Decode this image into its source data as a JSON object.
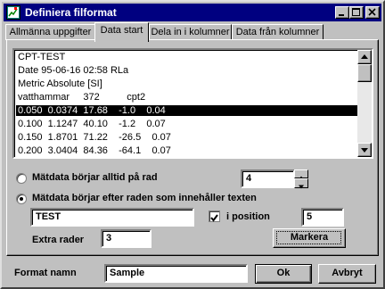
{
  "window": {
    "title": "Definiera filformat"
  },
  "tabs": [
    {
      "label": "Allmänna uppgifter"
    },
    {
      "label": "Data start"
    },
    {
      "label": "Dela in i kolumner"
    },
    {
      "label": "Data från kolumner"
    }
  ],
  "file_preview": {
    "lines": [
      "CPT-TEST",
      "Date 95-06-16 02:58 RLa",
      "Metric Absolute [SI]",
      "vatthammar     372          cpt2",
      "0.050  0.0374  17.68    -1.0    0.04",
      "0.100  1.1247  40.10    -1.2    0.07",
      "0.150  1.8701  71.22    -26.5    0.07",
      "0.200  3.0404  84.36    -64.1    0.07"
    ],
    "selected_index": 4
  },
  "options": {
    "start_row_label": "Mätdata börjar alltid på rad",
    "start_row_value": "4",
    "after_text_label": "Mätdata börjar efter raden som innehåller texten",
    "search_text": "TEST",
    "in_position_label": "i position",
    "position_value": "5",
    "extra_rows_label": "Extra rader",
    "extra_rows_value": "3",
    "mark_button_label": "Markera"
  },
  "footer": {
    "format_name_label": "Format namn",
    "format_name_value": "Sample",
    "ok_label": "Ok",
    "cancel_label": "Avbryt"
  },
  "colors": {
    "titlebar": "#000080",
    "face": "#c0c0c0",
    "selection": "#000000"
  }
}
